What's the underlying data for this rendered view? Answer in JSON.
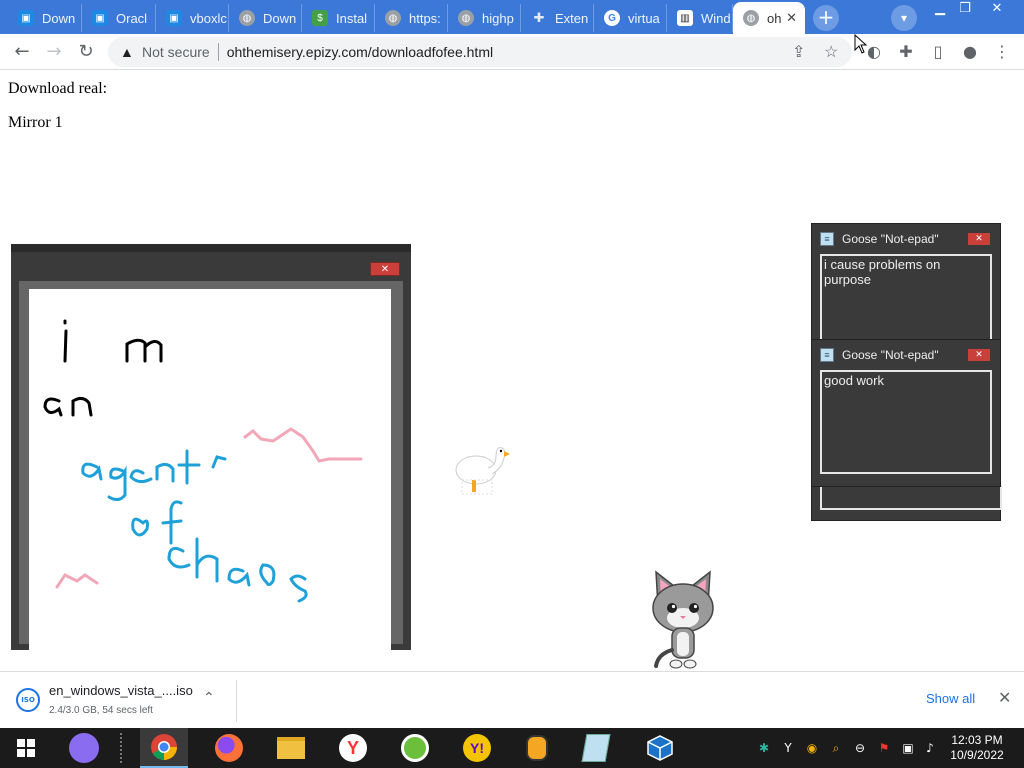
{
  "tabs": [
    {
      "title": "Down",
      "icon": "window-icon",
      "color": "#1e88e5"
    },
    {
      "title": "Oracl",
      "icon": "window-icon",
      "color": "#1e88e5"
    },
    {
      "title": "vboxlc",
      "icon": "window-icon",
      "color": "#1e88e5"
    },
    {
      "title": "Down",
      "icon": "globe-icon",
      "color": "#9aa0a6"
    },
    {
      "title": "Instal",
      "icon": "money-icon",
      "color": "#43a047"
    },
    {
      "title": "https:",
      "icon": "globe-icon",
      "color": "#9aa0a6"
    },
    {
      "title": "highp",
      "icon": "globe-icon",
      "color": "#9aa0a6"
    },
    {
      "title": "Exten",
      "icon": "puzzle-icon",
      "color": "#9aa0a6"
    },
    {
      "title": "virtua",
      "icon": "google-icon",
      "color": "#4285f4"
    },
    {
      "title": "Wind",
      "icon": "museum-icon",
      "color": "#222222"
    },
    {
      "title": "oh",
      "icon": "globe-icon",
      "color": "#9aa0a6",
      "active": true
    }
  ],
  "toolbar": {
    "not_secure": "Not secure",
    "url": "ohthemisery.epizy.com/downloadfofee.html"
  },
  "page": {
    "line1": "Download real:",
    "line2": "Mirror 1"
  },
  "drawing": {
    "text_lines": [
      "i m",
      "an",
      "agent",
      "of",
      "chaos"
    ],
    "ink_black": "#000000",
    "ink_blue": "#1ea0d8",
    "ink_pink": "#f2a7b8"
  },
  "notes": [
    {
      "title": "Goose \"Not-epad\"",
      "text": "i cause problems on purpose"
    },
    {
      "title": "Goose \"Not-epad\"",
      "text": "good work"
    }
  ],
  "download": {
    "icon_label": "ISO",
    "filename": "en_windows_vista_....iso",
    "status": "2.4/3.0 GB, 54 secs left",
    "show_all": "Show all"
  },
  "clock": {
    "time": "12:03 PM",
    "date": "10/9/2022"
  },
  "colors": {
    "tabstrip": "#3c78d8",
    "close_red": "#c9403a",
    "taskbar": "#1b1b1b"
  }
}
